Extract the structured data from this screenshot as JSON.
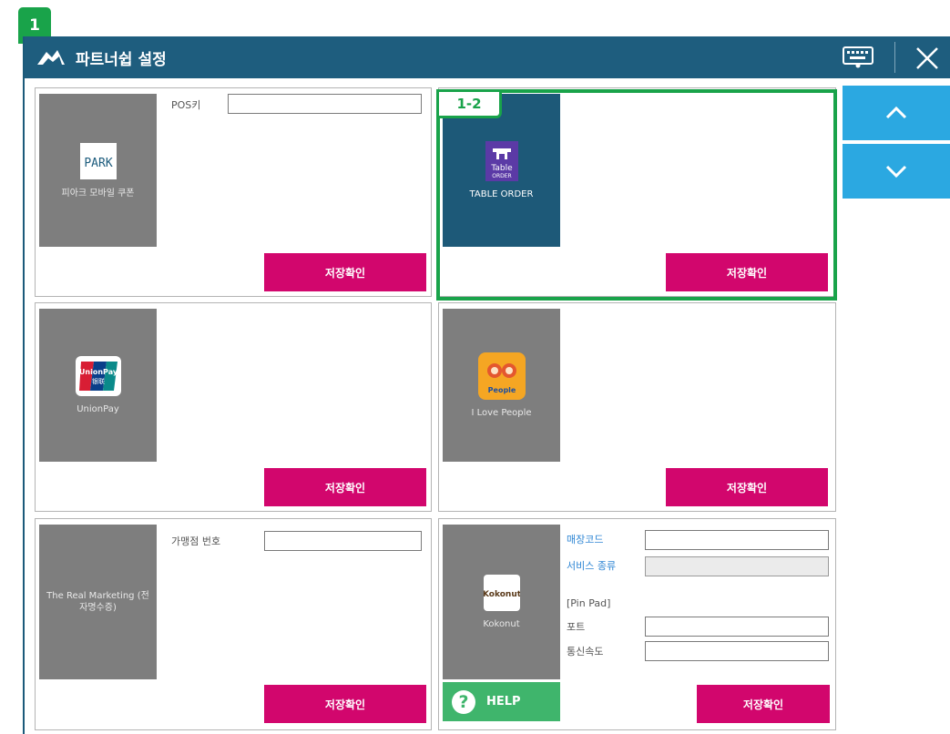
{
  "step_badge": "1",
  "window": {
    "title": "파트너쉽 설정"
  },
  "highlight_tag": "1-2",
  "partners": [
    {
      "name": "피아크 모바일 쿠폰",
      "logo_text": "PARK",
      "field_label": "POS키",
      "field_value": "",
      "save_label": "저장확인"
    },
    {
      "name": "TABLE ORDER",
      "logo_text_top": "Table",
      "logo_text_bottom": "ORDER",
      "save_label": "저장확인"
    },
    {
      "name": "UnionPay",
      "logo_text_top": "UnionPay",
      "logo_text_bottom": "银联",
      "save_label": "저장확인"
    },
    {
      "name": "I Love People",
      "logo_text": "People",
      "save_label": "저장확인"
    },
    {
      "name": "The Real Marketing (전자명수증)",
      "field_label": "가맹점 번호",
      "field_value": "",
      "save_label": "저장확인"
    },
    {
      "name": "Kokonut",
      "logo_text": "Kokonut",
      "save_label": "저장확인",
      "fields": {
        "store_code_label": "매장코드",
        "service_type_label": "서비스 종류",
        "pinpad_label": "[Pin Pad]",
        "port_label": "포트",
        "baud_label": "통신속도"
      },
      "help_label": "HELP"
    }
  ],
  "icons": {
    "logo": "handshake-logo-icon",
    "keyboard": "keyboard-icon",
    "close": "close-icon",
    "up": "chevron-up-icon",
    "down": "chevron-down-icon",
    "help": "question-icon"
  },
  "colors": {
    "titlebar": "#1e5d7e",
    "save_button": "#d2066d",
    "scroll_button": "#2ba8e1",
    "highlight": "#19a34a"
  }
}
